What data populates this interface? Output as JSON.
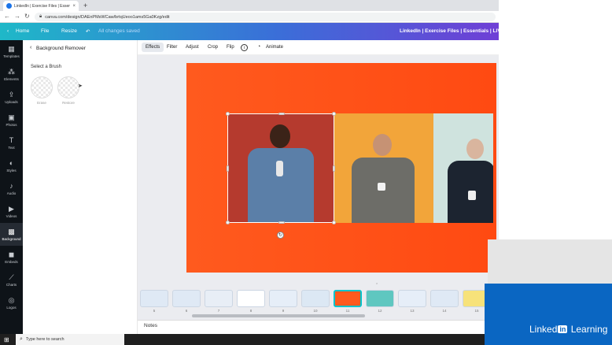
{
  "browser": {
    "tab_title": "LinkedIn | Exercise Files | Essenti...",
    "tab_close": "×",
    "new_tab": "+",
    "url": "canva.com/design/DAEnPMsWCaw/brtqUeoo1ams5Ga0Kzg/edit"
  },
  "header": {
    "home": "Home",
    "file": "File",
    "resize": "Resize",
    "status": "All changes saved",
    "doc_title": "LinkedIn | Exercise Files | Essentials | LIVE"
  },
  "rail": [
    {
      "label": "Templates",
      "icon": "▦"
    },
    {
      "label": "Elements",
      "icon": "⁂"
    },
    {
      "label": "Uploads",
      "icon": "⇪"
    },
    {
      "label": "Photos",
      "icon": "▣"
    },
    {
      "label": "Text",
      "icon": "T"
    },
    {
      "label": "Styles",
      "icon": "◐"
    },
    {
      "label": "Audio",
      "icon": "♪"
    },
    {
      "label": "Videos",
      "icon": "▶"
    },
    {
      "label": "Background",
      "icon": "▩"
    },
    {
      "label": "Embeds",
      "icon": "◼"
    },
    {
      "label": "Charts",
      "icon": "⟋"
    },
    {
      "label": "Logos",
      "icon": "◎"
    }
  ],
  "panel": {
    "title": "Background Remover",
    "subtitle": "Select a Brush",
    "brushes": [
      "Erase",
      "Restore"
    ]
  },
  "toolbar": {
    "effects": "Effects",
    "filter": "Filter",
    "adjust": "Adjust",
    "crop": "Crop",
    "flip": "Flip",
    "info": "i",
    "animate": "Animate"
  },
  "pages": [
    "5",
    "6",
    "7",
    "8",
    "9",
    "10",
    "11",
    "12",
    "13",
    "14",
    "15"
  ],
  "notes": "Notes",
  "brand": {
    "pre": "Linked",
    "in": "in",
    "post": " Learning"
  },
  "taskbar": {
    "search_placeholder": "Type here to search"
  },
  "colors": {
    "canvas": "#ff4f17",
    "accent_selected_page": "#00c4cc",
    "linkedin_blue": "#0a66c2"
  }
}
